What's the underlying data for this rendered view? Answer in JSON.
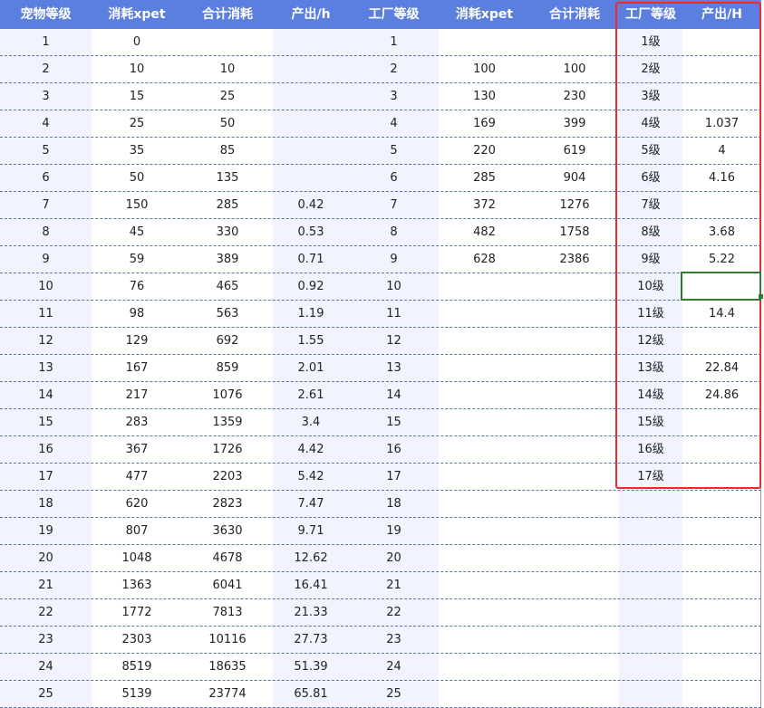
{
  "headers": [
    "宠物等级",
    "消耗xpet",
    "合计消耗",
    "产出/h",
    "工厂等级",
    "消耗xpet",
    "合计消耗",
    "工厂等级",
    "产出/H"
  ],
  "rows": [
    [
      "1",
      "0",
      "",
      "",
      "1",
      "",
      "",
      "1级",
      ""
    ],
    [
      "2",
      "10",
      "10",
      "",
      "2",
      "100",
      "100",
      "2级",
      ""
    ],
    [
      "3",
      "15",
      "25",
      "",
      "3",
      "130",
      "230",
      "3级",
      ""
    ],
    [
      "4",
      "25",
      "50",
      "",
      "4",
      "169",
      "399",
      "4级",
      "1.037"
    ],
    [
      "5",
      "35",
      "85",
      "",
      "5",
      "220",
      "619",
      "5级",
      "4"
    ],
    [
      "6",
      "50",
      "135",
      "",
      "6",
      "285",
      "904",
      "6级",
      "4.16"
    ],
    [
      "7",
      "150",
      "285",
      "0.42",
      "7",
      "372",
      "1276",
      "7级",
      ""
    ],
    [
      "8",
      "45",
      "330",
      "0.53",
      "8",
      "482",
      "1758",
      "8级",
      "3.68"
    ],
    [
      "9",
      "59",
      "389",
      "0.71",
      "9",
      "628",
      "2386",
      "9级",
      "5.22"
    ],
    [
      "10",
      "76",
      "465",
      "0.92",
      "10",
      "",
      "",
      "10级",
      ""
    ],
    [
      "11",
      "98",
      "563",
      "1.19",
      "11",
      "",
      "",
      "11级",
      "14.4"
    ],
    [
      "12",
      "129",
      "692",
      "1.55",
      "12",
      "",
      "",
      "12级",
      ""
    ],
    [
      "13",
      "167",
      "859",
      "2.01",
      "13",
      "",
      "",
      "13级",
      "22.84"
    ],
    [
      "14",
      "217",
      "1076",
      "2.61",
      "14",
      "",
      "",
      "14级",
      "24.86"
    ],
    [
      "15",
      "283",
      "1359",
      "3.4",
      "15",
      "",
      "",
      "15级",
      ""
    ],
    [
      "16",
      "367",
      "1726",
      "4.42",
      "16",
      "",
      "",
      "16级",
      ""
    ],
    [
      "17",
      "477",
      "2203",
      "5.42",
      "17",
      "",
      "",
      "17级",
      ""
    ],
    [
      "18",
      "620",
      "2823",
      "7.47",
      "18",
      "",
      "",
      "",
      ""
    ],
    [
      "19",
      "807",
      "3630",
      "9.71",
      "19",
      "",
      "",
      "",
      ""
    ],
    [
      "20",
      "1048",
      "4678",
      "12.62",
      "20",
      "",
      "",
      "",
      ""
    ],
    [
      "21",
      "1363",
      "6041",
      "16.41",
      "21",
      "",
      "",
      "",
      ""
    ],
    [
      "22",
      "1772",
      "7813",
      "21.33",
      "22",
      "",
      "",
      "",
      ""
    ],
    [
      "23",
      "2303",
      "10116",
      "27.73",
      "23",
      "",
      "",
      "",
      ""
    ],
    [
      "24",
      "8519",
      "18635",
      "51.39",
      "24",
      "",
      "",
      "",
      ""
    ],
    [
      "25",
      "5139",
      "23774",
      "65.81",
      "25",
      "",
      "",
      "",
      ""
    ]
  ],
  "colors": {
    "header_bg": "#5b7fde",
    "stripe_bg": "#f1f4ff",
    "highlight_border": "#ee2a2a",
    "selection_border": "#2e7d32"
  }
}
